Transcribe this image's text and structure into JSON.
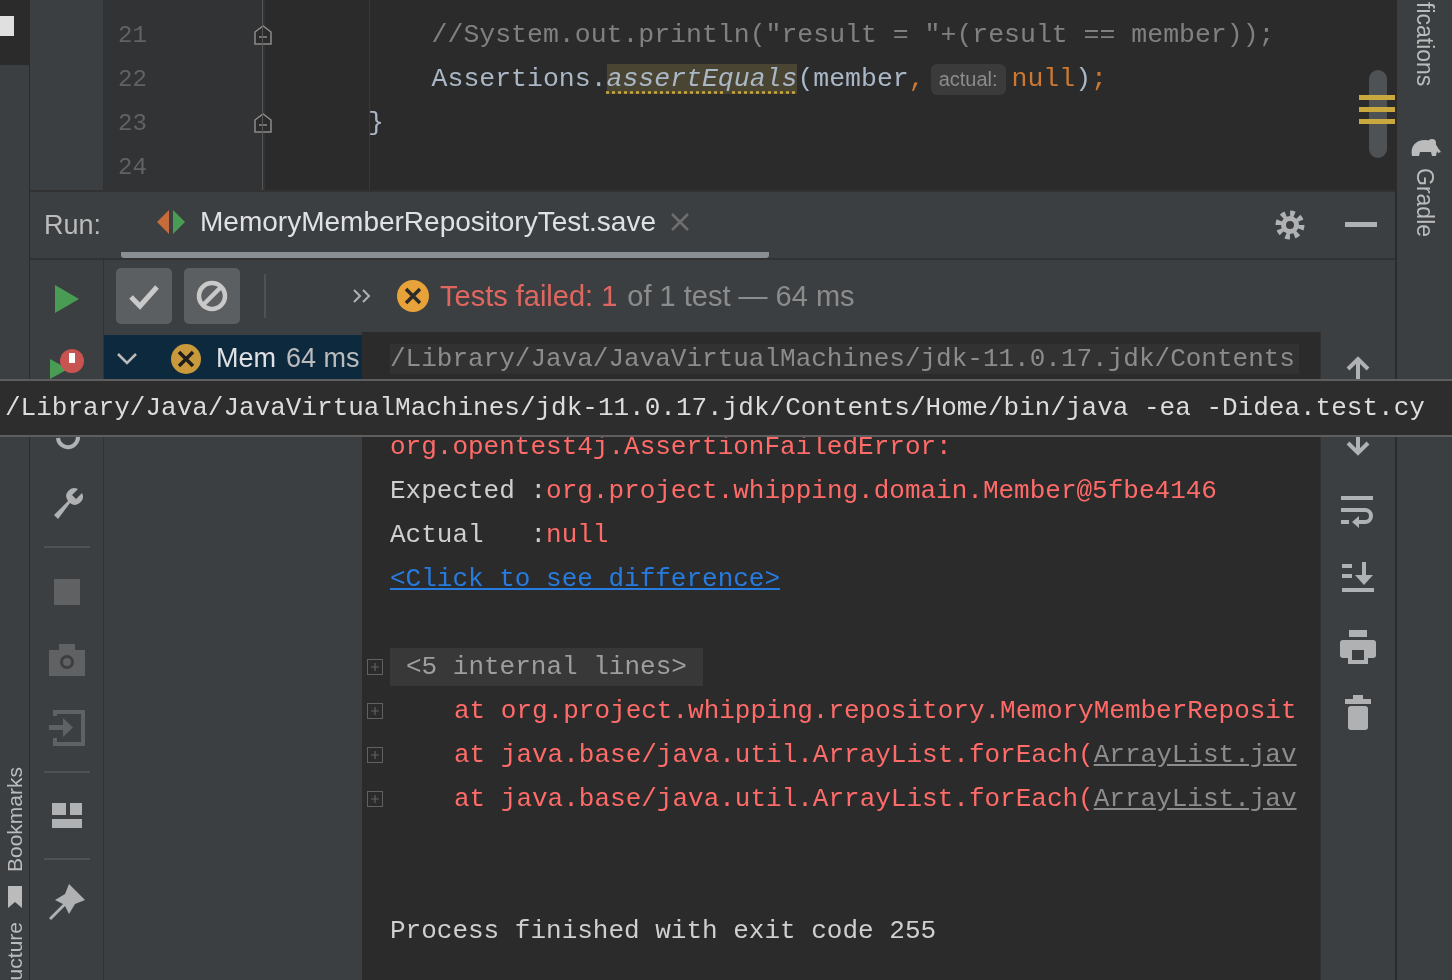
{
  "left_stripe": {
    "tabs": [
      {
        "label": "Bookmarks",
        "kind": "bookmarks"
      },
      {
        "label": "ucture",
        "kind": "plain"
      }
    ]
  },
  "right_stripe": {
    "tabs": [
      {
        "label": "fications",
        "kind": "plain"
      },
      {
        "label": "Gradle",
        "kind": "gradle"
      }
    ]
  },
  "editor": {
    "lines": [
      {
        "number": "21",
        "fold": true,
        "segments": [
          {
            "kind": "comment",
            "text": "    //System.out.println(\"result = \"+(result == member));"
          }
        ]
      },
      {
        "number": "22",
        "fold": false,
        "segments": [
          {
            "kind": "plain",
            "text": "    Assertions."
          },
          {
            "kind": "warning",
            "text": "assertEquals"
          },
          {
            "kind": "plain",
            "text": "(member"
          },
          {
            "kind": "keyword",
            "text": ","
          },
          {
            "kind": "hint",
            "text": "actual:"
          },
          {
            "kind": "keyword",
            "text": "null"
          },
          {
            "kind": "plain",
            "text": ")"
          },
          {
            "kind": "keyword",
            "text": ";"
          }
        ]
      },
      {
        "number": "23",
        "fold": true,
        "segments": [
          {
            "kind": "plain",
            "text": "}"
          }
        ]
      },
      {
        "number": "24",
        "fold": false
      }
    ]
  },
  "run": {
    "title": "Run:",
    "tab": {
      "label": "MemoryMemberRepositoryTest.save",
      "selected": true
    },
    "toggles": [
      {
        "kind": "passed",
        "selected": true
      },
      {
        "kind": "ignored",
        "selected": true
      }
    ],
    "status": {
      "failed": "Tests failed: 1",
      "rest": "of 1 test — 64 ms"
    },
    "tree": [
      {
        "name": "Mem",
        "time": "64 ms",
        "selected": true,
        "expanded": true
      }
    ],
    "console": {
      "lines": [
        {
          "kind": "path",
          "text": "/Library/Java/JavaVirtualMachines/jdk-11.0.17.jdk/Contents"
        },
        {
          "kind": "spacer"
        },
        {
          "kind": "error",
          "text": "org.opentest4j.AssertionFailedError:"
        },
        {
          "kind": "field",
          "label": "Expected :",
          "value": "org.project.whipping.domain.Member@5fbe4146"
        },
        {
          "kind": "field",
          "label": "Actual   :",
          "value": "null"
        },
        {
          "kind": "link",
          "text": "<Click to see difference>"
        },
        {
          "kind": "spacer"
        },
        {
          "kind": "folded",
          "text": "<5 internal lines>"
        },
        {
          "kind": "trace",
          "text": "at org.project.whipping.repository.MemoryMemberReposit"
        },
        {
          "kind": "trace",
          "text": "at java.base/java.util.ArrayList.forEach(",
          "link": "ArrayList.jav"
        },
        {
          "kind": "trace",
          "text": "at java.base/java.util.ArrayList.forEach(",
          "link": "ArrayList.jav"
        },
        {
          "kind": "spacer"
        },
        {
          "kind": "spacer"
        },
        {
          "kind": "plain",
          "text": "Process finished with exit code 255"
        }
      ]
    }
  },
  "tooltip": {
    "text": "/Library/Java/JavaVirtualMachines/jdk-11.0.17.jdk/Contents/Home/bin/java -ea -Didea.test.cy"
  }
}
